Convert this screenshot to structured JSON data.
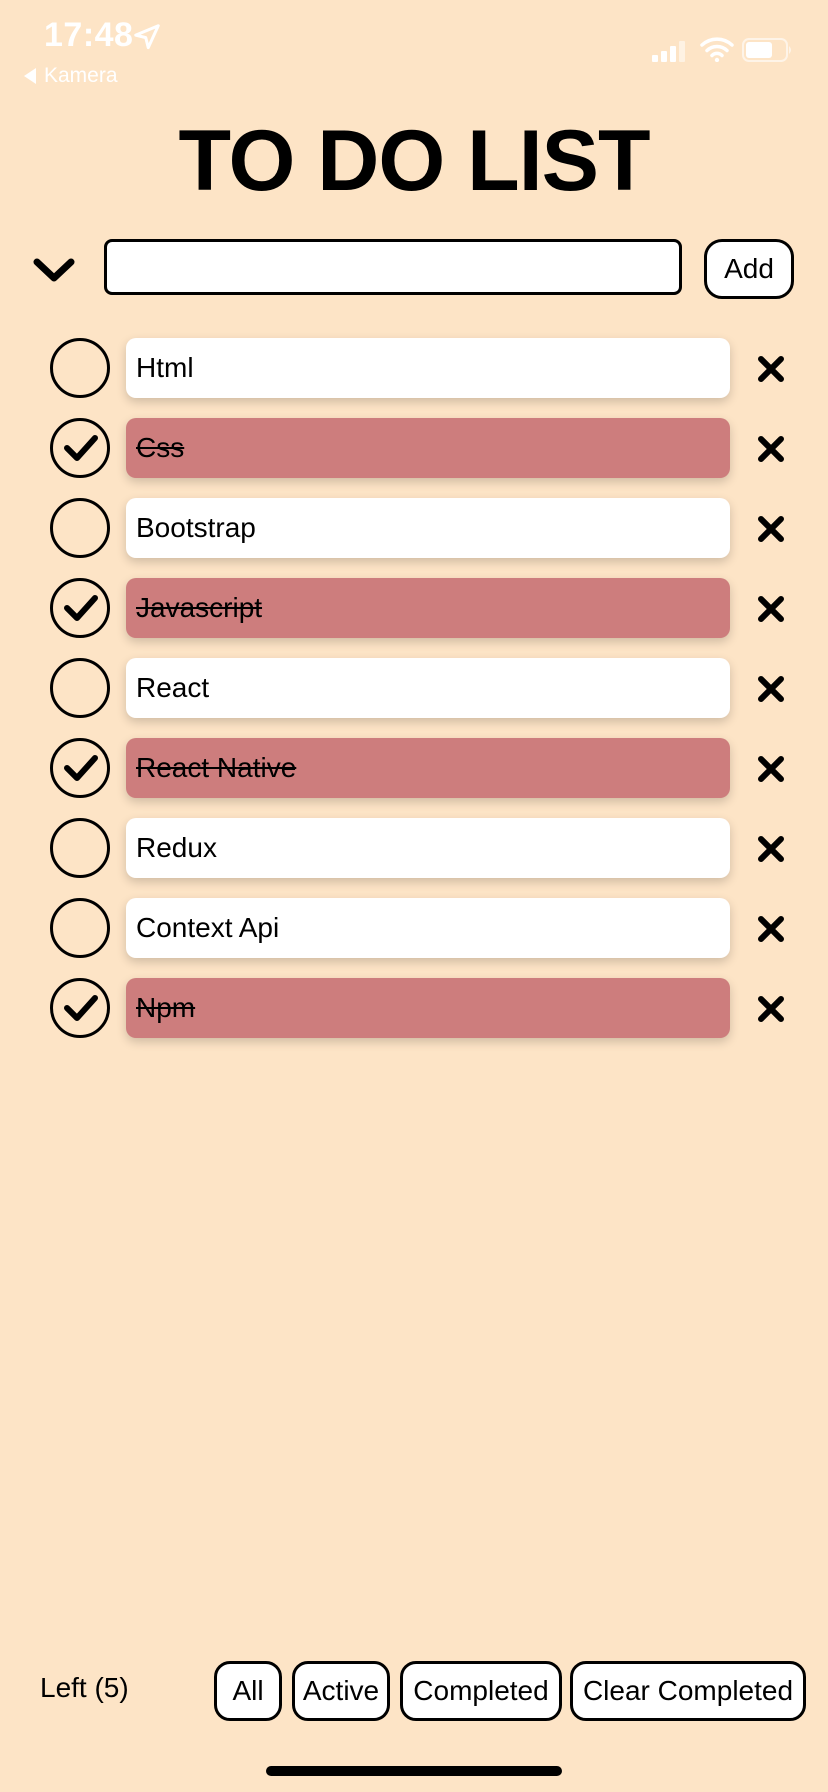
{
  "status_bar": {
    "time": "17:48",
    "back_label": "Kamera",
    "icons": [
      "location-arrow-icon",
      "cellular-signal-icon",
      "wifi-icon",
      "battery-icon"
    ]
  },
  "title": "TO DO LIST",
  "input": {
    "value": "",
    "placeholder": ""
  },
  "add_label": "Add",
  "todos": [
    {
      "text": "Html",
      "completed": false
    },
    {
      "text": "Css",
      "completed": true
    },
    {
      "text": "Bootstrap",
      "completed": false
    },
    {
      "text": "Javascript",
      "completed": true
    },
    {
      "text": "React",
      "completed": false
    },
    {
      "text": "React Native",
      "completed": true
    },
    {
      "text": "Redux",
      "completed": false
    },
    {
      "text": "Context Api",
      "completed": false
    },
    {
      "text": "Npm",
      "completed": true
    }
  ],
  "footer": {
    "left_count": "Left (5)",
    "filters": {
      "all": "All",
      "active": "Active",
      "completed": "Completed",
      "clear": "Clear Completed"
    }
  },
  "colors": {
    "background": "#fde4c6",
    "completed_item": "#cd7d7d",
    "item": "#ffffff"
  }
}
